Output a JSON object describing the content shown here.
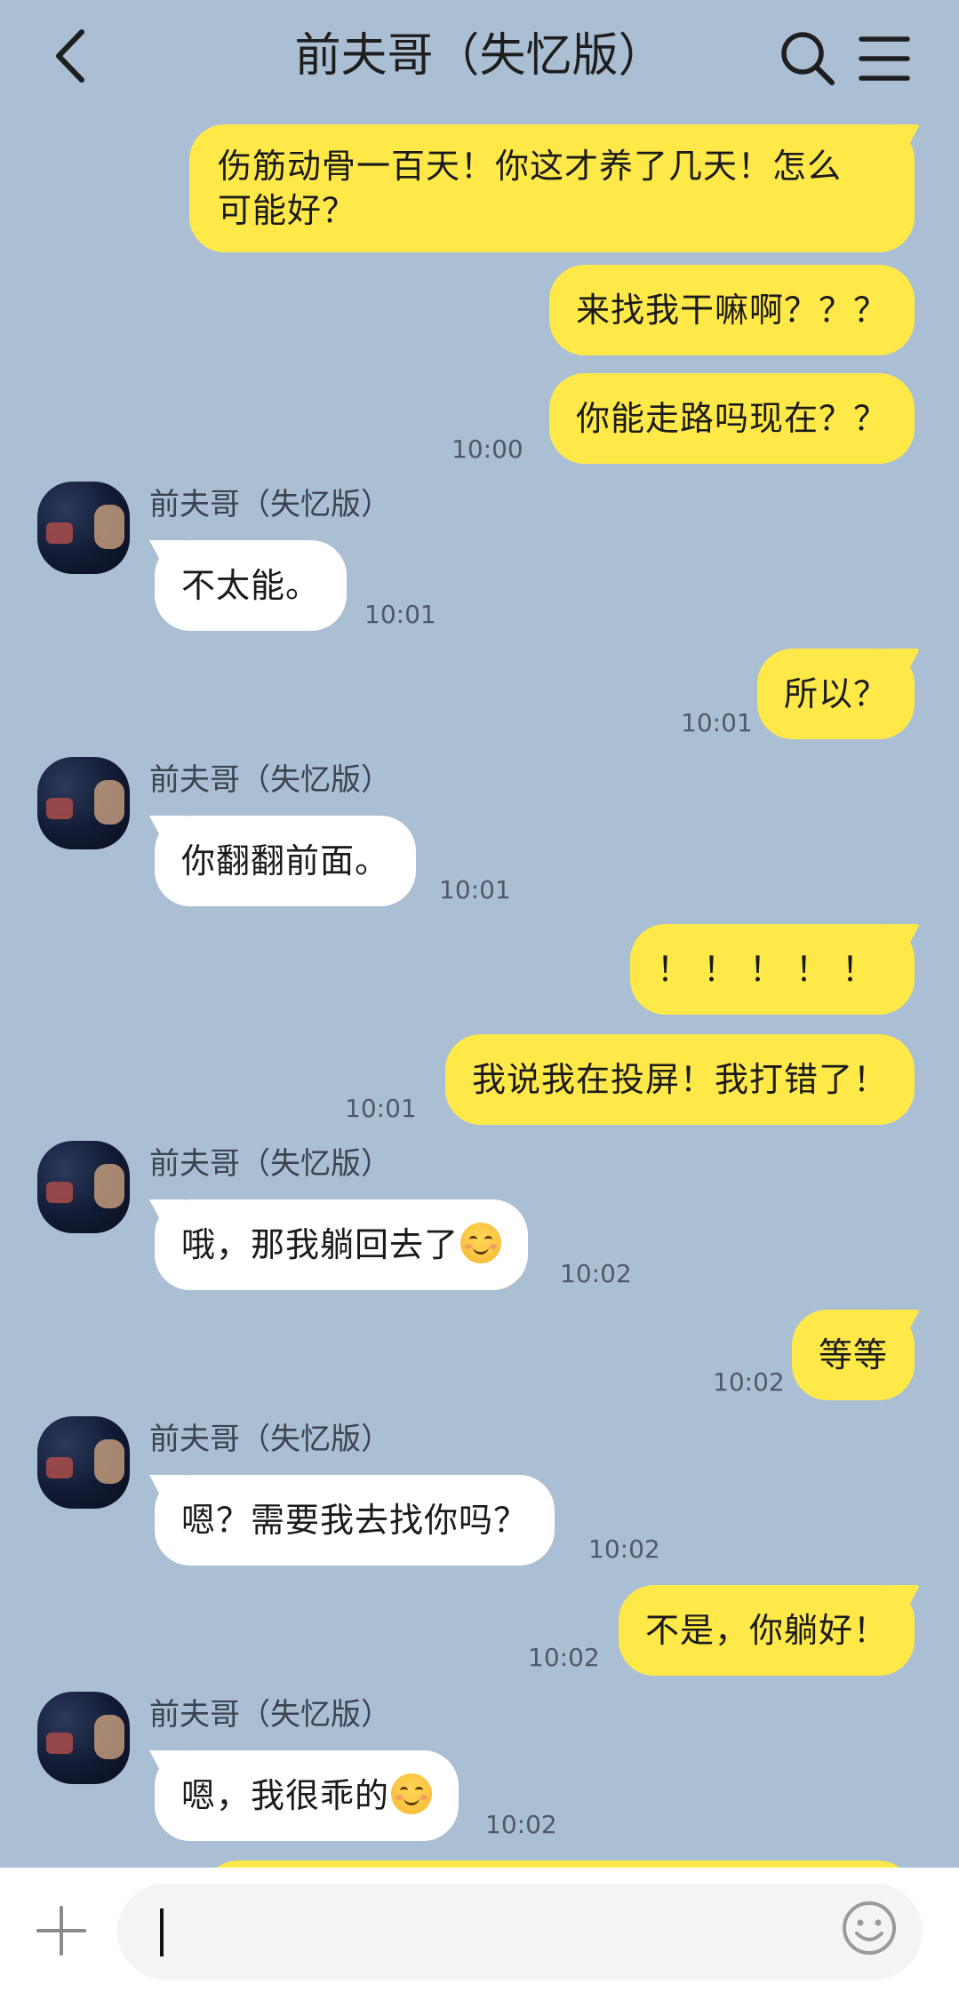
{
  "header": {
    "title": "前夫哥（失忆版）",
    "back_icon": "chevron-left-icon",
    "search_icon": "search-icon",
    "menu_icon": "hamburger-menu-icon"
  },
  "messages": [
    {
      "dir": "out",
      "lines": [
        "伤筋动骨一百天！你这才养了几天！怎么",
        "可能好？"
      ],
      "time": ""
    },
    {
      "dir": "out",
      "text": "来找我干嘛啊？？？",
      "time": ""
    },
    {
      "dir": "out",
      "text": "你能走路吗现在？？",
      "time": "10:00"
    },
    {
      "dir": "in",
      "sender": "前夫哥（失忆版）",
      "text": "不太能。",
      "time": "10:01"
    },
    {
      "dir": "out",
      "text": "所以？",
      "time": "10:01"
    },
    {
      "dir": "in",
      "sender": "前夫哥（失忆版）",
      "text": "你翻翻前面。",
      "time": "10:01"
    },
    {
      "dir": "out",
      "text": "！！！！！",
      "time": ""
    },
    {
      "dir": "out",
      "text": "我说我在投屏！我打错了！",
      "time": "10:01"
    },
    {
      "dir": "in",
      "sender": "前夫哥（失忆版）",
      "text": "哦，那我躺回去了",
      "emoji": "smiling-face-emoji",
      "time": "10:02"
    },
    {
      "dir": "out",
      "text": "等等",
      "time": "10:02"
    },
    {
      "dir": "in",
      "sender": "前夫哥（失忆版）",
      "text": "嗯？需要我去找你吗？",
      "time": "10:02"
    },
    {
      "dir": "out",
      "text": "不是，你躺好！",
      "time": "10:02"
    },
    {
      "dir": "in",
      "sender": "前夫哥（失忆版）",
      "text": "嗯，我很乖的",
      "emoji": "smiling-face-emoji",
      "time": "10:02"
    }
  ],
  "input": {
    "plus_icon": "plus-icon",
    "emoji_icon": "emoji-smile-icon",
    "value": "",
    "placeholder": ""
  },
  "colors": {
    "background": "#abbfd4",
    "outgoing_bubble": "#ffe949",
    "incoming_bubble": "#ffffff"
  }
}
